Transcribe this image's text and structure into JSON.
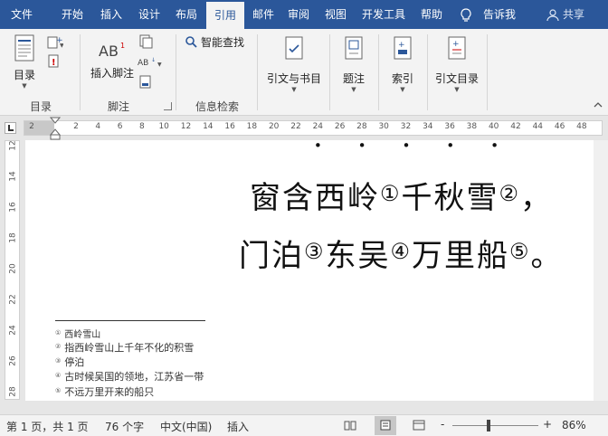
{
  "tabs": [
    "文件",
    "开始",
    "插入",
    "设计",
    "布局",
    "引用",
    "邮件",
    "审阅",
    "视图",
    "开发工具",
    "帮助"
  ],
  "active_tab": "引用",
  "tell_me": "告诉我",
  "share": "共享",
  "ribbon": {
    "toc_label": "目录",
    "insert_footnote_label": "插入脚注",
    "smart_lookup_label": "智能查找",
    "citations_label": "引文与书目",
    "captions_label": "题注",
    "index_label": "索引",
    "toa_label": "引文目录",
    "groups": {
      "toc": "目录",
      "footnotes": "脚注",
      "research": "信息检索"
    }
  },
  "ruler_ticks": [
    "2",
    "2",
    "4",
    "6",
    "8",
    "10",
    "12",
    "14",
    "16",
    "18",
    "20",
    "22",
    "24",
    "26",
    "28",
    "30",
    "32",
    "34",
    "36",
    "38",
    "40",
    "42",
    "44",
    "46",
    "48"
  ],
  "vruler_ticks": [
    "12",
    "14",
    "16",
    "18",
    "20",
    "22",
    "24",
    "26",
    "28"
  ],
  "document": {
    "line2": {
      "a": "窗含西岭",
      "ref1": "①",
      "b": "千秋雪",
      "ref2": "②",
      "c": "，"
    },
    "line3": {
      "a": "门泊",
      "ref3": "③",
      "b": "东吴",
      "ref4": "④",
      "c": "万里船",
      "ref5": "⑤",
      "d": "。"
    },
    "footnotes": [
      {
        "mark": "①",
        "text": "西岭雪山"
      },
      {
        "mark": "②",
        "text": "指西岭雪山上千年不化的积雪"
      },
      {
        "mark": "③",
        "text": "停泊"
      },
      {
        "mark": "④",
        "text": "古时候吴国的领地，江苏省一带"
      },
      {
        "mark": "⑤",
        "text": "不远万里开来的船只"
      }
    ]
  },
  "status": {
    "page": "第 1 页，共 1 页",
    "words": "76 个字",
    "language": "中文(中国)",
    "mode": "插入",
    "zoom": "86%",
    "zoom_minus": "-",
    "zoom_plus": "+"
  },
  "colors": {
    "accent": "#2b579a"
  }
}
